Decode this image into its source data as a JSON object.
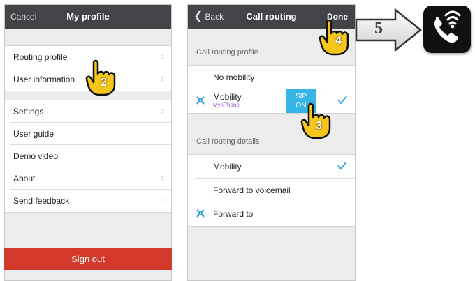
{
  "left_screen": {
    "nav": {
      "left": "Cancel",
      "title": "My profile"
    },
    "group1": [
      {
        "label": "Routing profile",
        "chevron": true
      },
      {
        "label": "User information",
        "chevron": true
      }
    ],
    "group2": [
      {
        "label": "Settings",
        "chevron": true
      },
      {
        "label": "User guide",
        "chevron": false
      },
      {
        "label": "Demo video",
        "chevron": false
      },
      {
        "label": "About",
        "chevron": true
      },
      {
        "label": "Send feedback",
        "chevron": true
      }
    ],
    "signout": "Sign out"
  },
  "right_screen": {
    "nav": {
      "back": "Back",
      "title": "Call routing",
      "done": "Done"
    },
    "profile_header": "Call routing profile",
    "profile_rows": [
      {
        "label": "No mobility"
      },
      {
        "label": "Mobility",
        "sub": "My iPhone",
        "sip": "SIP ON"
      }
    ],
    "details_header": "Call routing details",
    "details_rows": [
      {
        "label": "Mobility"
      },
      {
        "label": "Forward to voicemail"
      },
      {
        "label": "Forward to"
      }
    ]
  },
  "steps": {
    "two": "2",
    "three": "3",
    "four": "4",
    "five": "5"
  },
  "colors": {
    "navbar": "#424447",
    "signout": "#d33a2c",
    "accent": "#35b4e6",
    "check": "#3aa7e6"
  },
  "icons": [
    "pointing-hand-icon",
    "chevron-right-icon",
    "checkmark-icon",
    "mobility-icon",
    "phone-wifi-icon",
    "arrow-right-icon"
  ]
}
